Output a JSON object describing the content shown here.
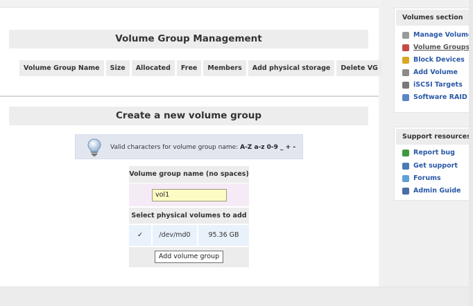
{
  "main": {
    "vg_title": "Volume Group Management",
    "vg_columns": [
      "Volume Group Name",
      "Size",
      "Allocated",
      "Free",
      "Members",
      "Add physical storage",
      "Delete VG"
    ],
    "create_title": "Create a new volume group",
    "info": {
      "text": "Valid characters for volume group name:",
      "chars": "A-Z a-z 0-9 _ + -",
      "icon": "lightbulb-icon"
    },
    "form": {
      "name_label": "Volume group name (no spaces)",
      "name_value": "vol1",
      "pv_label": "Select physical volumes to add",
      "pv_rows": [
        {
          "checked": "✓",
          "device": "/dev/md0",
          "size": "95.36 GB"
        }
      ],
      "submit_label": "Add volume group"
    }
  },
  "sidebar": {
    "volumes": {
      "title": "Volumes section",
      "items": [
        {
          "label": "Manage Volumes",
          "icon": "disks-icon",
          "color": "#9a9a9a"
        },
        {
          "label": "Volume Groups",
          "icon": "volume-groups-icon",
          "color": "#c44a4a"
        },
        {
          "label": "Block Devices",
          "icon": "block-devices-icon",
          "color": "#d8a824"
        },
        {
          "label": "Add Volume",
          "icon": "add-volume-icon",
          "color": "#8c8c8c"
        },
        {
          "label": "iSCSI Targets",
          "icon": "iscsi-icon",
          "color": "#7a7a7a"
        },
        {
          "label": "Software RAID",
          "icon": "raid-icon",
          "color": "#5a86c4"
        }
      ]
    },
    "support": {
      "title": "Support resources",
      "items": [
        {
          "label": "Report bug",
          "icon": "bug-icon",
          "color": "#3e9a3e"
        },
        {
          "label": "Get support",
          "icon": "support-icon",
          "color": "#4a7ab4"
        },
        {
          "label": "Forums",
          "icon": "forums-icon",
          "color": "#5ea0d8"
        },
        {
          "label": "Admin Guide",
          "icon": "guide-icon",
          "color": "#4a6ea8"
        }
      ]
    }
  }
}
